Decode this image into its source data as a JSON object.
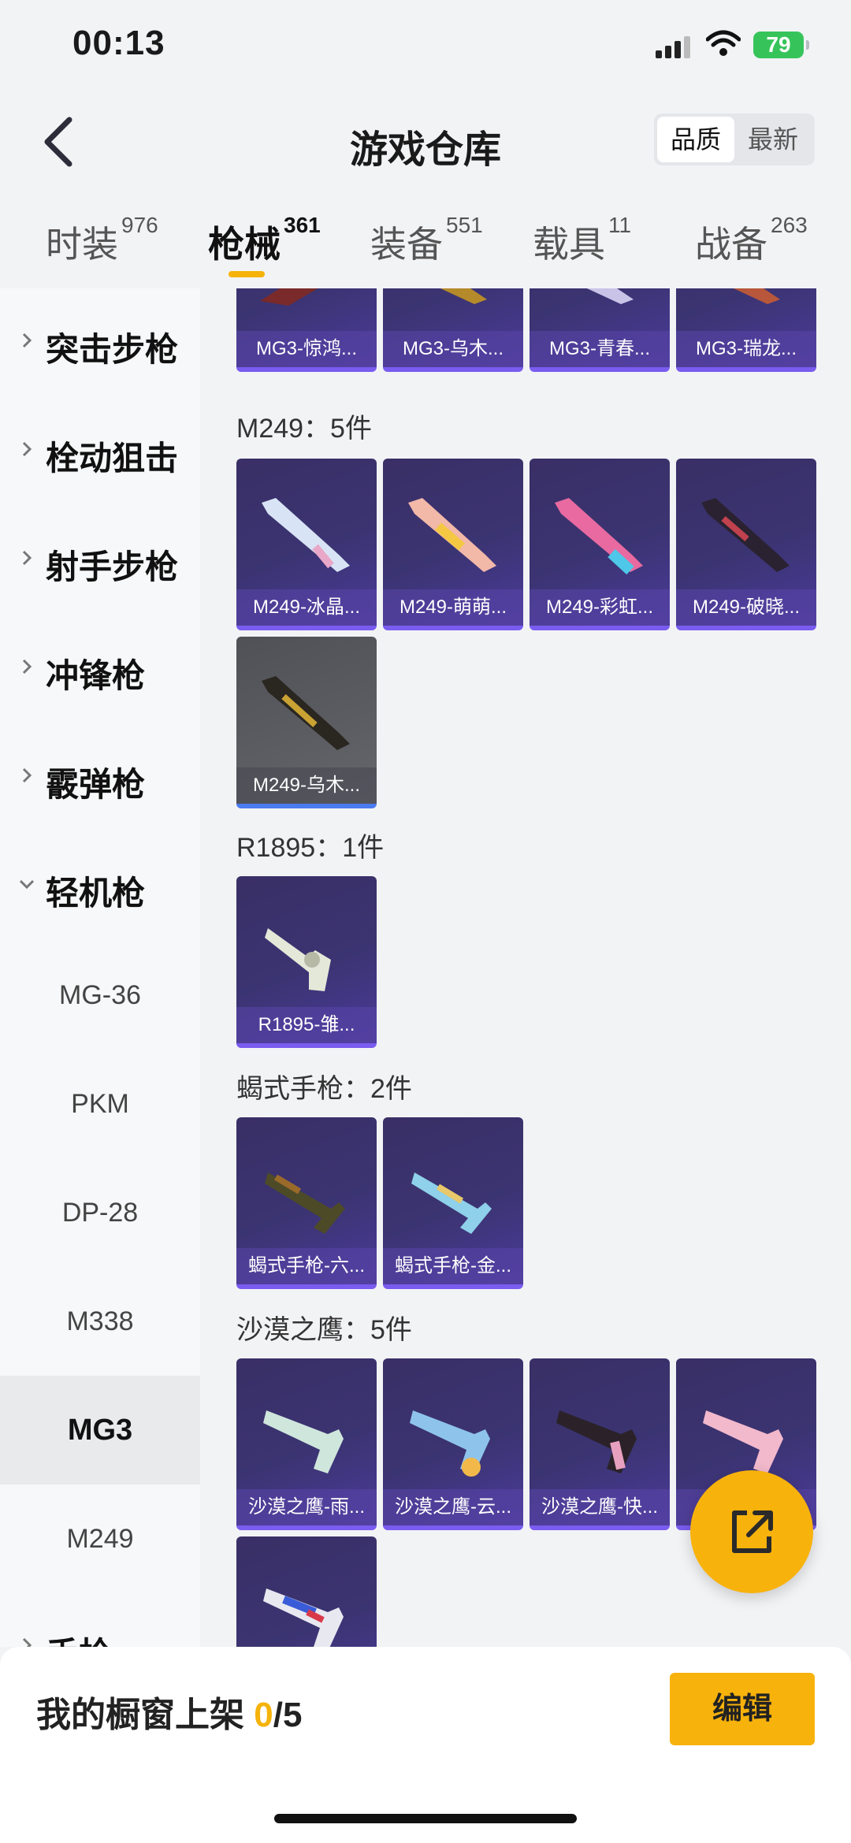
{
  "status": {
    "time": "00:13",
    "battery": "79"
  },
  "header": {
    "title": "游戏仓库",
    "sort_quality": "品质",
    "sort_latest": "最新"
  },
  "tabs": [
    {
      "label": "时装",
      "count": "976"
    },
    {
      "label": "枪械",
      "count": "361"
    },
    {
      "label": "装备",
      "count": "551"
    },
    {
      "label": "载具",
      "count": "11"
    },
    {
      "label": "战备",
      "count": "263"
    }
  ],
  "sidebar": {
    "categories": [
      "突击步枪",
      "栓动狙击",
      "射手步枪",
      "冲锋枪",
      "霰弹枪",
      "轻机枪",
      "手枪"
    ],
    "subitems": [
      "MG-36",
      "PKM",
      "DP-28",
      "M338",
      "MG3",
      "M249"
    ]
  },
  "content": {
    "top_row": [
      "MG3-惊鸿...",
      "MG3-乌木...",
      "MG3-青春...",
      "MG3-瑞龙..."
    ],
    "sections": [
      {
        "title": "M249：5件",
        "items": [
          "M249-冰晶...",
          "M249-萌萌...",
          "M249-彩虹...",
          "M249-破晓...",
          "M249-乌木..."
        ]
      },
      {
        "title": "R1895：1件",
        "items": [
          "R1895-雏..."
        ]
      },
      {
        "title": "蝎式手枪：2件",
        "items": [
          "蝎式手枪-六...",
          "蝎式手枪-金..."
        ]
      },
      {
        "title": "沙漠之鹰：5件",
        "items": [
          "沙漠之鹰-雨...",
          "沙漠之鹰-云...",
          "沙漠之鹰-快...",
          "沙..."
        ]
      }
    ]
  },
  "bottom": {
    "shelf_label": "我的橱窗上架",
    "shelf_count": "0",
    "shelf_total": "/5",
    "edit_label": "编辑"
  },
  "colors": {
    "accent": "#f8b20c",
    "card_purple": "#3b3472",
    "card_grey": "#5c5d62"
  }
}
